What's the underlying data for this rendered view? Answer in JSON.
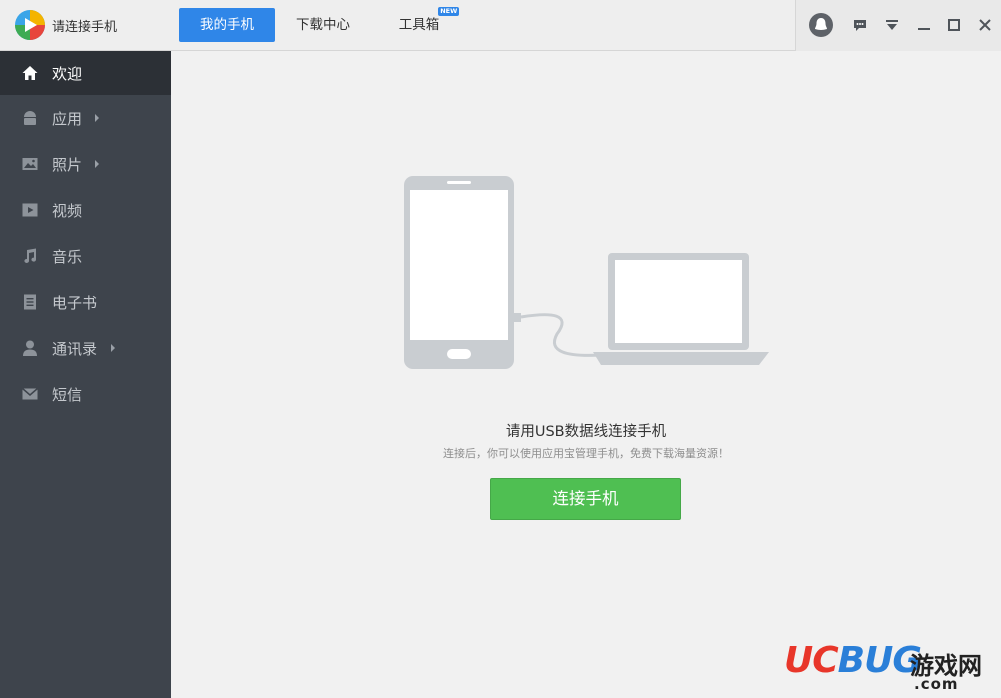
{
  "app": {
    "title": "请连接手机"
  },
  "tabs": [
    {
      "label": "我的手机",
      "active": true
    },
    {
      "label": "下载中心",
      "active": false
    },
    {
      "label": "工具箱",
      "active": false,
      "badge": "NEW"
    }
  ],
  "window_controls": [
    "avatar-icon",
    "message-icon",
    "dropdown-menu-icon",
    "minimize-icon",
    "maximize-icon",
    "close-icon"
  ],
  "sidebar": {
    "items": [
      {
        "label": "欢迎",
        "icon": "home-icon",
        "active": true,
        "has_arrow": false
      },
      {
        "label": "应用",
        "icon": "android-icon",
        "active": false,
        "has_arrow": true
      },
      {
        "label": "照片",
        "icon": "photo-icon",
        "active": false,
        "has_arrow": true
      },
      {
        "label": "视频",
        "icon": "video-icon",
        "active": false,
        "has_arrow": false
      },
      {
        "label": "音乐",
        "icon": "music-icon",
        "active": false,
        "has_arrow": false
      },
      {
        "label": "电子书",
        "icon": "ebook-icon",
        "active": false,
        "has_arrow": false
      },
      {
        "label": "通讯录",
        "icon": "contacts-icon",
        "active": false,
        "has_arrow": true
      },
      {
        "label": "短信",
        "icon": "sms-icon",
        "active": false,
        "has_arrow": false
      }
    ]
  },
  "main": {
    "headline": "请用USB数据线连接手机",
    "subline": "连接后，你可以使用应用宝管理手机，免费下载海量资源！",
    "connect_button": "连接手机"
  },
  "watermark": {
    "brand_a": "UC",
    "brand_b": "BUG",
    "cn": "游戏网",
    "domain": ".com"
  },
  "colors": {
    "accent": "#2f86e8",
    "sidebar_bg": "#3e444c",
    "sidebar_active": "#2c3036",
    "button_green": "#4fbf52"
  }
}
